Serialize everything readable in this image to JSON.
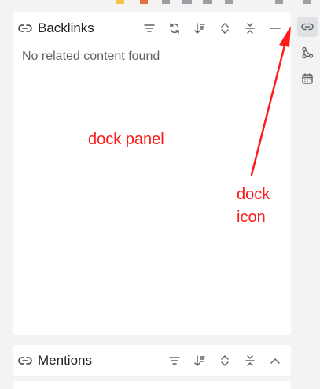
{
  "backlinks": {
    "title": "Backlinks",
    "empty_text": "No related content found",
    "toolbar": [
      "sort-icon",
      "refresh-icon",
      "sort-desc-icon",
      "expand-icon",
      "collapse-icon",
      "minimize-icon"
    ]
  },
  "mentions": {
    "title": "Mentions",
    "toolbar": [
      "sort-icon",
      "sort-desc-icon",
      "expand-icon",
      "collapse-icon",
      "chevron-up-icon"
    ]
  },
  "dock": {
    "items": [
      "link-icon",
      "graph-icon",
      "calendar-icon"
    ],
    "active": "link-icon"
  },
  "annotations": {
    "panel_label": "dock panel",
    "icon_label_line1": "dock",
    "icon_label_line2": "icon",
    "color": "#ff1a1a"
  },
  "colors": {
    "panel_bg": "#ffffff",
    "app_bg": "#f3f3f3",
    "icon": "#5f6368",
    "active_dock_bg": "#dfe1e5"
  }
}
